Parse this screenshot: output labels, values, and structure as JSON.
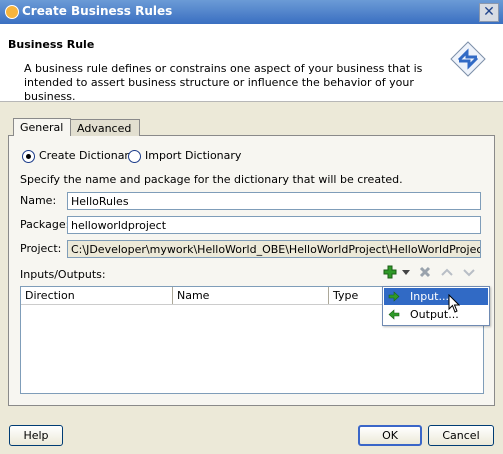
{
  "window": {
    "title": "Create Business Rules",
    "close_glyph": "✕"
  },
  "header": {
    "title": "Business Rule",
    "description": "A business rule defines or constrains one aspect of your business that is intended to assert business structure or influence the behavior of your business."
  },
  "tabs": [
    {
      "label": "General",
      "selected": true
    },
    {
      "label": "Advanced",
      "selected": false
    }
  ],
  "options": [
    {
      "label": "Create Dictionary",
      "selected": true
    },
    {
      "label": "Import Dictionary",
      "selected": false
    }
  ],
  "instruction": "Specify the name and package for the dictionary that will be created.",
  "form": {
    "name": {
      "label": "Name:",
      "value": "HelloRules"
    },
    "package": {
      "label": "Package:",
      "value": "helloworldproject"
    },
    "project": {
      "label": "Project:",
      "value": "C:\\JDeveloper\\mywork\\HelloWorld_OBE\\HelloWorldProject\\HelloWorldProject.jpr"
    }
  },
  "io": {
    "label": "Inputs/Outputs:",
    "columns": [
      "Direction",
      "Name",
      "Type"
    ],
    "menu": [
      {
        "label": "Input...",
        "highlighted": true
      },
      {
        "label": "Output...",
        "highlighted": false
      }
    ]
  },
  "buttons": {
    "help": "Help",
    "ok": "OK",
    "cancel": "Cancel"
  },
  "icons": {
    "add": "add-icon",
    "dropdown": "dropdown-arrow-icon",
    "delete": "delete-icon",
    "move_up": "move-up-icon",
    "move_down": "move-down-icon",
    "rules": "business-rule-icon"
  },
  "colors": {
    "title_bar": "#3a6fc1",
    "highlight": "#316ac5",
    "add_green": "#2f9a28"
  }
}
